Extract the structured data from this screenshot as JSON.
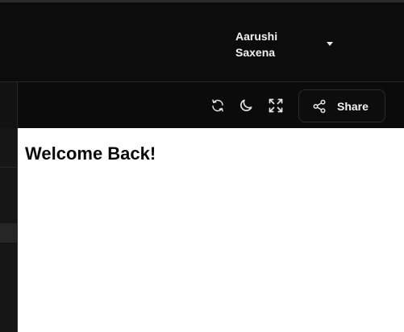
{
  "header": {
    "user": {
      "first_name": "Aarushi",
      "last_name": "Saxena",
      "menu_icon": "chevron-down-icon"
    }
  },
  "toolbar": {
    "icons": [
      "refresh-icon",
      "moon-icon",
      "fullscreen-icon"
    ],
    "share": {
      "label": "Share",
      "icon": "share-icon"
    }
  },
  "main": {
    "heading": "Welcome Back!"
  },
  "colors": {
    "background": "#0b0b0b",
    "content_bg": "#ffffff",
    "text_light": "#f2f2f2",
    "text_dark": "#0a0a0a"
  }
}
